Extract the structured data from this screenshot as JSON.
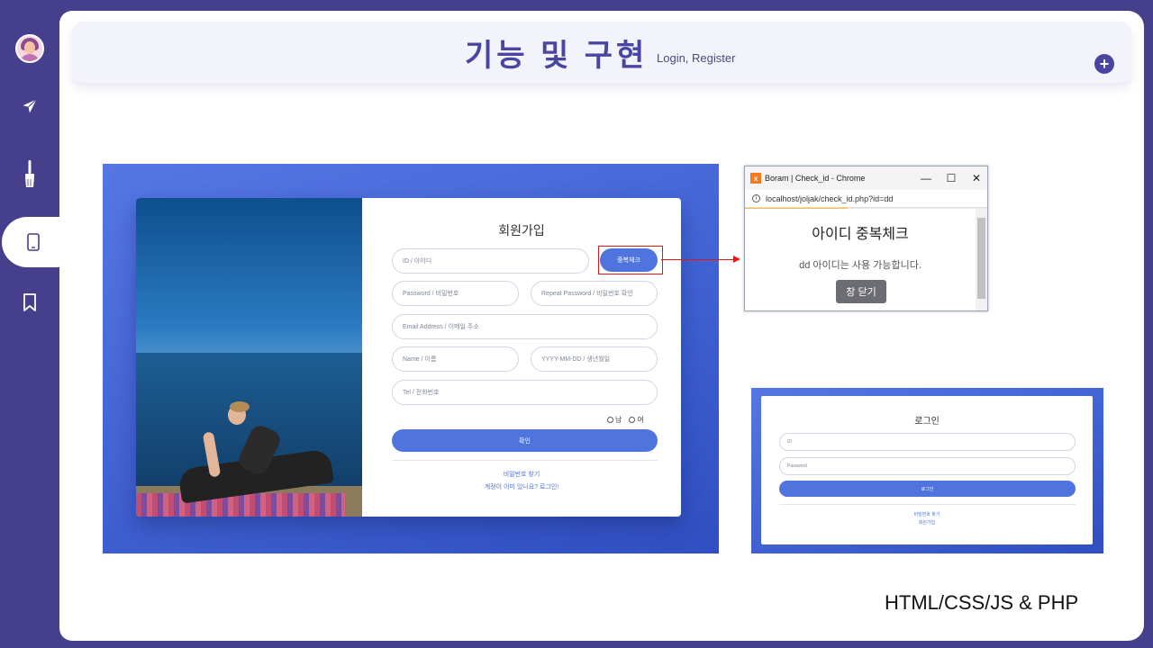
{
  "sidebar": {
    "items": [
      {
        "icon": "avatar"
      },
      {
        "icon": "paper-plane-icon"
      },
      {
        "icon": "brush-icon"
      },
      {
        "icon": "mobile-icon",
        "active": true
      },
      {
        "icon": "bookmark-icon"
      }
    ]
  },
  "header": {
    "title": "기능 및 구현",
    "subtitle": "Login, Register",
    "add_icon": "+"
  },
  "signup": {
    "title": "회원가입",
    "id_placeholder": "ID / 아이디",
    "dup_check_label": "중복체크",
    "password_placeholder": "Password / 비밀번호",
    "repeat_password_placeholder": "Repeat Password / 비밀번호 확인",
    "email_placeholder": "Email Address / 이메일 주소",
    "name_placeholder": "Name / 이름",
    "birth_placeholder": "YYYY-MM-DD / 생년월일",
    "tel_placeholder": "Tel / 전화번호",
    "gender_male": "남",
    "gender_female": "여",
    "submit_label": "확인",
    "find_password_link": "비밀번호 찾기",
    "login_link": "계정이 이미 있나요? 로그인!"
  },
  "popup": {
    "window_title": "Boram | Check_id - Chrome",
    "url": "localhost/joljak/check_id.php?id=dd",
    "heading": "아이디 중복체크",
    "message": "dd 아이디는 사용 가능합니다.",
    "close_label": "창 닫기",
    "minimize": "—",
    "maximize": "☐",
    "close": "✕"
  },
  "login": {
    "title": "로그인",
    "id_placeholder": "ID",
    "password_placeholder": "Password",
    "submit_label": "로그인",
    "find_password_link": "비밀번호 찾기",
    "register_link": "회원가입"
  },
  "footer": {
    "tech": "HTML/CSS/JS & PHP"
  },
  "colors": {
    "accent": "#4a45a0",
    "sidebar": "#463f8c",
    "button": "#4f74dd"
  }
}
